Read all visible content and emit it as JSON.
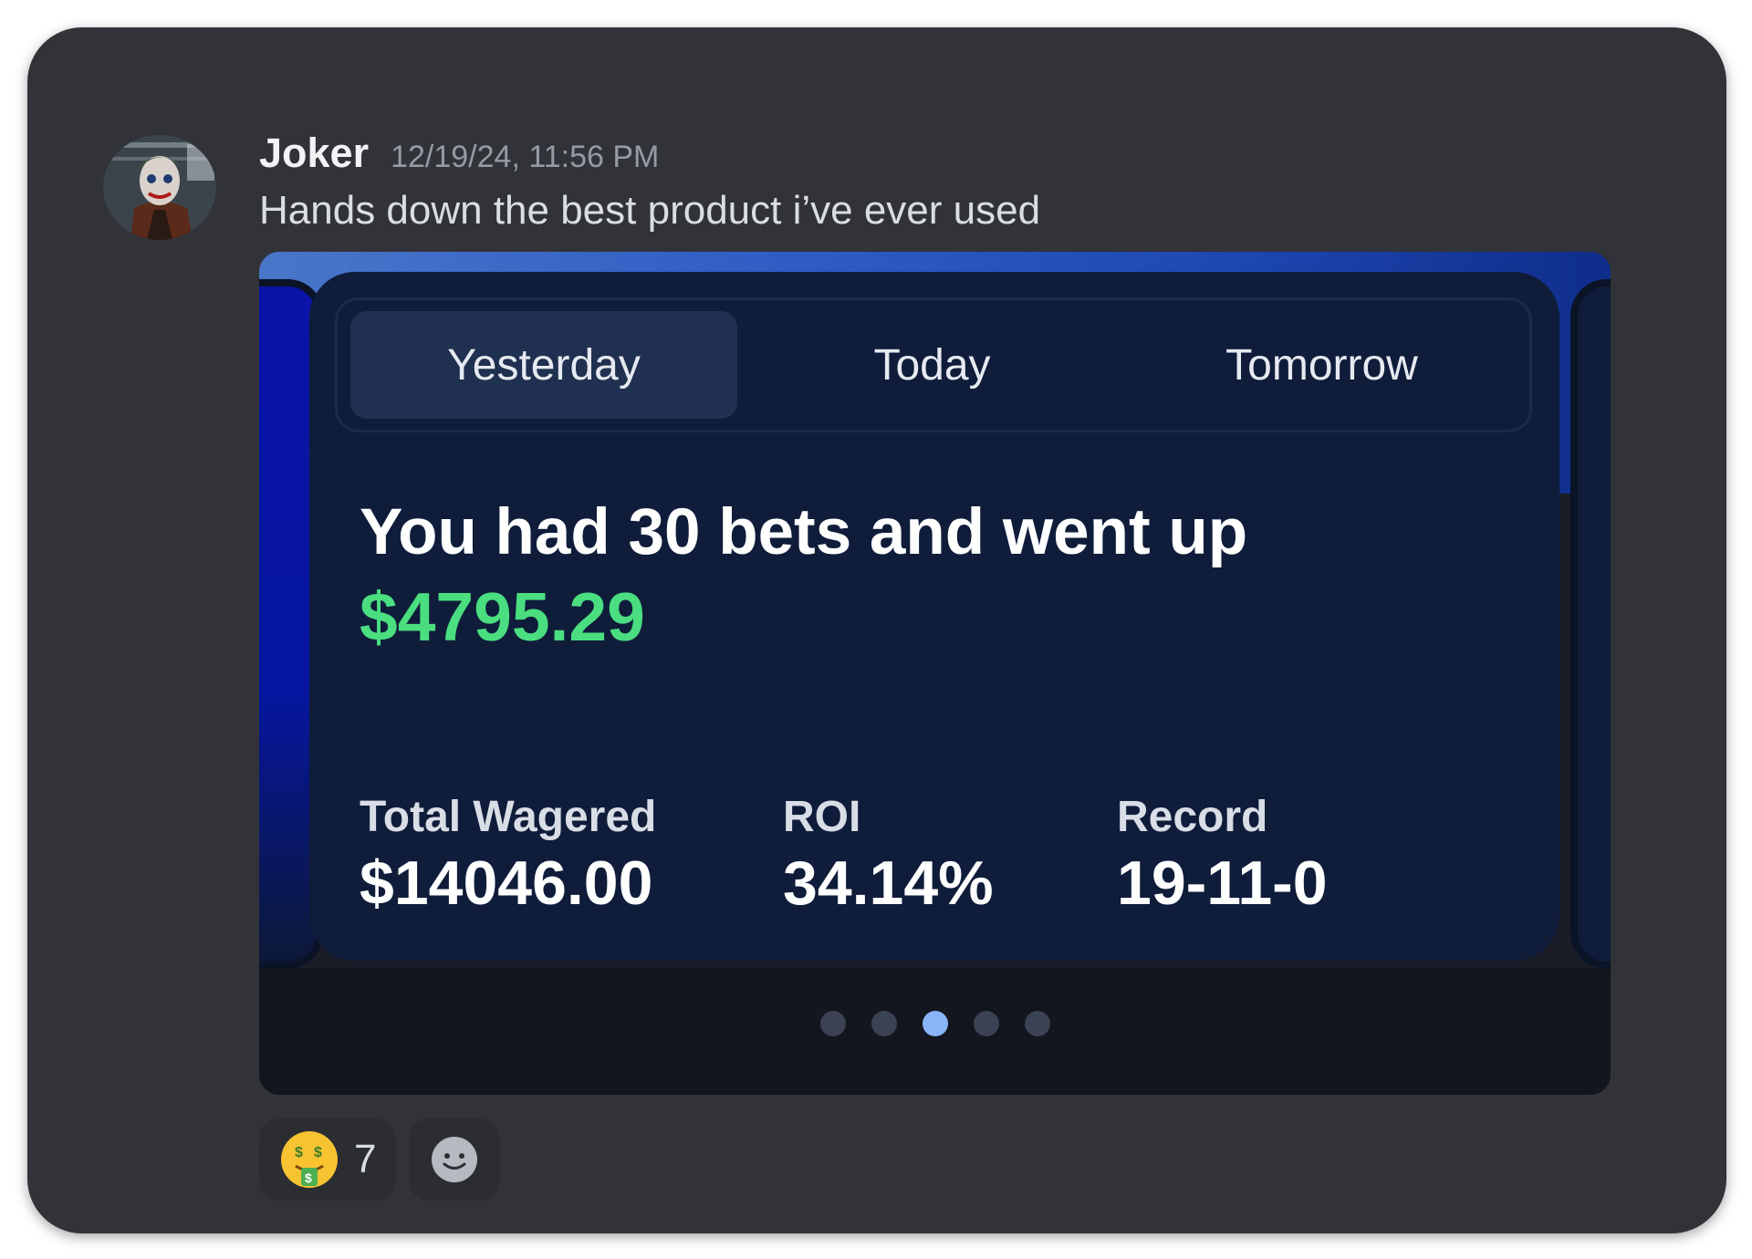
{
  "message": {
    "username": "Joker",
    "timestamp": "12/19/24, 11:56 PM",
    "text": "Hands down the best product i’ve ever used"
  },
  "embed": {
    "tabs": [
      {
        "label": "Yesterday",
        "active": true
      },
      {
        "label": "Today",
        "active": false
      },
      {
        "label": "Tomorrow",
        "active": false
      }
    ],
    "headline": "You had 30 bets and went up",
    "amount": "$4795.29",
    "stats": [
      {
        "label": "Total Wagered",
        "value": "$14046.00"
      },
      {
        "label": "ROI",
        "value": "34.14%"
      },
      {
        "label": "Record",
        "value": "19-11-0"
      }
    ],
    "carousel": {
      "count": 5,
      "active_index": 2
    },
    "colors": {
      "accent_green": "#4ade80",
      "card_background": "#0f1d3a",
      "active_dot": "#8ab4f8"
    }
  },
  "reactions": [
    {
      "emoji": "money-mouth-face-icon",
      "count": "7"
    },
    {
      "emoji": "add-reaction-icon"
    }
  ]
}
